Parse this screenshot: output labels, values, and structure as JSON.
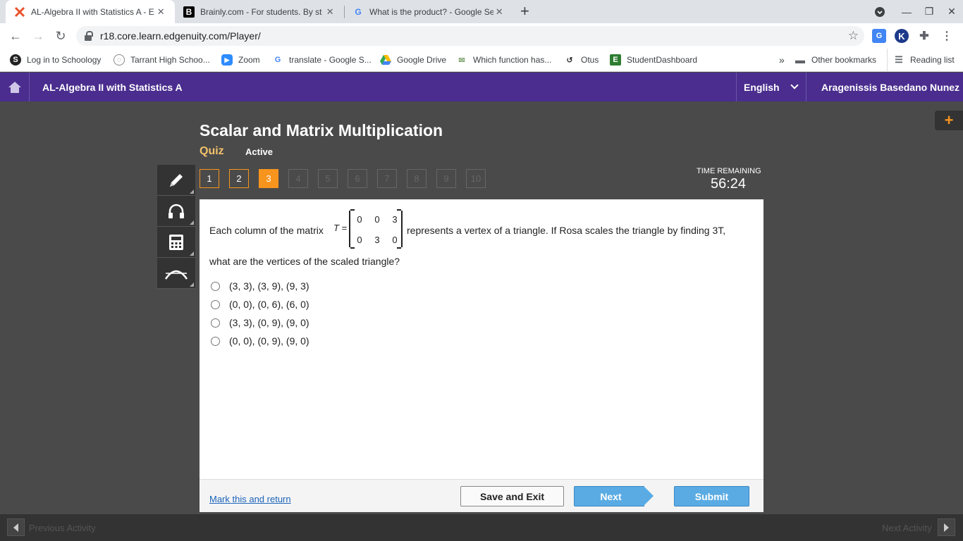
{
  "browser": {
    "tabs": [
      {
        "title": "AL-Algebra II with Statistics A - E",
        "icon": "edgenuity-x-icon"
      },
      {
        "title": "Brainly.com - For students. By st",
        "icon": "brainly-b-icon"
      },
      {
        "title": "What is the product? - Google Se",
        "icon": "google-g-icon"
      }
    ],
    "url": "r18.core.learn.edgenuity.com/Player/",
    "bookmarks": [
      {
        "label": "Log in to Schoology"
      },
      {
        "label": "Tarrant High Schoo..."
      },
      {
        "label": "Zoom"
      },
      {
        "label": "translate - Google S..."
      },
      {
        "label": "Google Drive"
      },
      {
        "label": "Which function has..."
      },
      {
        "label": "Otus"
      },
      {
        "label": "StudentDashboard"
      }
    ],
    "other_bookmarks": "Other bookmarks",
    "reading_list": "Reading list",
    "overflow": "»"
  },
  "app": {
    "course_title": "AL-Algebra II with Statistics A",
    "language": "English",
    "user_name": "Aragenissis Basedano Nunez"
  },
  "quiz": {
    "lesson_title": "Scalar and Matrix Multiplication",
    "type_label": "Quiz",
    "status": "Active",
    "questions": [
      "1",
      "2",
      "3",
      "4",
      "5",
      "6",
      "7",
      "8",
      "9",
      "10"
    ],
    "current_question": 3,
    "time_remaining_label": "TIME REMAINING",
    "time_remaining": "56:24"
  },
  "question": {
    "text_before": "Each column of the matrix",
    "matrix_var": "T =",
    "matrix": [
      [
        "0",
        "0",
        "3"
      ],
      [
        "0",
        "3",
        "0"
      ]
    ],
    "text_after": "represents a vertex of a triangle. If Rosa scales the triangle by finding 3T,",
    "text_line2": "what are the vertices of the scaled triangle?",
    "options": [
      "(3, 3), (3, 9), (9, 3)",
      "(0, 0), (0, 6), (6, 0)",
      "(3, 3), (0, 9), (9, 0)",
      "(0, 0), (0, 9), (9, 0)"
    ]
  },
  "footer": {
    "mark_link": "Mark this and return",
    "save_exit": "Save and Exit",
    "next": "Next",
    "submit": "Submit",
    "previous_activity": "Previous Activity",
    "next_activity": "Next Activity"
  },
  "colors": {
    "app_bar": "#4a2d8e",
    "accent_orange": "#f7941d",
    "button_blue": "#5aabe3",
    "background": "#4a4a4a"
  }
}
